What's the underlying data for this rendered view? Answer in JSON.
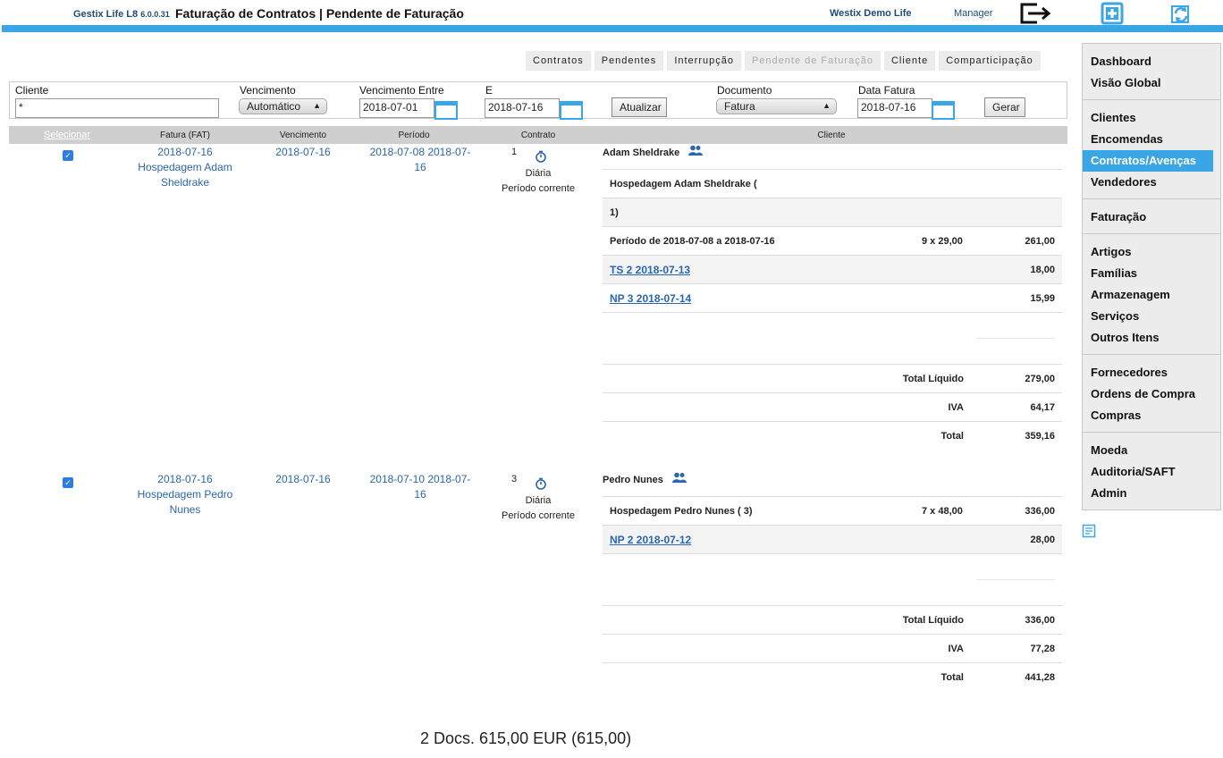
{
  "header": {
    "app_name": "Gestix Life L8",
    "version": "6.0.0.31",
    "title": "Faturação de Contratos | Pendente de Faturação",
    "company": "Westix Demo Life",
    "user": "Manager",
    "icons": [
      "logout-icon",
      "add-icon",
      "sync-icon"
    ],
    "accent_color": "#3aa6e6"
  },
  "tabs": [
    {
      "label": "Contratos",
      "disabled": false
    },
    {
      "label": "Pendentes",
      "disabled": false
    },
    {
      "label": "Interrupção",
      "disabled": false
    },
    {
      "label": "Pendente de Faturação",
      "disabled": true
    },
    {
      "label": "Cliente",
      "disabled": false
    },
    {
      "label": "Comparticipação",
      "disabled": false
    }
  ],
  "filters": {
    "cliente_label": "Cliente",
    "cliente_value": "*",
    "vencimento_label": "Vencimento",
    "vencimento_value": "Automático",
    "entre_label": "Vencimento Entre",
    "entre_value": "2018-07-01",
    "e_label": "E",
    "e_value": "2018-07-16",
    "atualizar_label": "Atualizar",
    "documento_label": "Documento",
    "documento_value": "Fatura",
    "data_fatura_label": "Data Fatura",
    "data_fatura_value": "2018-07-16",
    "gerar_label": "Gerar"
  },
  "table": {
    "headers": {
      "select": "Selecionar",
      "fatura": "Fatura (FAT)",
      "vencimento": "Vencimento",
      "periodo": "Período",
      "contrato": "Contrato",
      "cliente": "Cliente"
    },
    "rows": [
      {
        "checked": true,
        "fatura_date": "2018-07-16",
        "fatura_desc": "Hospedagem Adam Sheldrake",
        "vencimento": "2018-07-16",
        "periodo": "2018-07-08 2018-07-16",
        "contrato_num": "1",
        "contrato_freq": "Diária",
        "contrato_period": "Período corrente",
        "client_name": "Adam Sheldrake",
        "lines": [
          {
            "text": "Hospedagem Adam Sheldrake (",
            "qty": "",
            "amount": "",
            "alt": false,
            "link": false
          },
          {
            "text": "1)",
            "qty": "",
            "amount": "",
            "alt": true,
            "link": false
          },
          {
            "text": "Período de 2018-07-08 a 2018-07-16",
            "qty": "9 x 29,00",
            "amount": "261,00",
            "alt": false,
            "link": false
          },
          {
            "text": "TS 2 2018-07-13",
            "qty": "",
            "amount": "18,00",
            "alt": true,
            "link": true
          },
          {
            "text": "NP 3 2018-07-14",
            "qty": "",
            "amount": "15,99",
            "alt": false,
            "link": true
          }
        ],
        "totals": [
          {
            "label": "Total Líquido",
            "value": "279,00"
          },
          {
            "label": "IVA",
            "value": "64,17"
          },
          {
            "label": "Total",
            "value": "359,16"
          }
        ]
      },
      {
        "checked": true,
        "fatura_date": "2018-07-16",
        "fatura_desc": "Hospedagem Pedro Nunes",
        "vencimento": "2018-07-16",
        "periodo": "2018-07-10 2018-07-16",
        "contrato_num": "3",
        "contrato_freq": "Diária",
        "contrato_period": "Período corrente",
        "client_name": "Pedro Nunes",
        "lines": [
          {
            "text": "Hospedagem Pedro Nunes ( 3)",
            "qty": "7 x 48,00",
            "amount": "336,00",
            "alt": false,
            "link": false
          },
          {
            "text": "NP 2 2018-07-12",
            "qty": "",
            "amount": "28,00",
            "alt": true,
            "link": true
          }
        ],
        "totals": [
          {
            "label": "Total Líquido",
            "value": "336,00"
          },
          {
            "label": "IVA",
            "value": "77,28"
          },
          {
            "label": "Total",
            "value": "441,28"
          }
        ]
      }
    ]
  },
  "summary": "2 Docs. 615,00 EUR (615,00)",
  "sidebar": {
    "groups": [
      [
        {
          "label": "Dashboard"
        },
        {
          "label": "Visão Global"
        }
      ],
      [
        {
          "label": "Clientes"
        },
        {
          "label": "Encomendas"
        },
        {
          "label": "Contratos/Avenças",
          "active": true
        },
        {
          "label": "Vendedores"
        }
      ],
      [
        {
          "label": "Faturação"
        }
      ],
      [
        {
          "label": "Artigos"
        },
        {
          "label": "Famílias"
        },
        {
          "label": "Armazenagem"
        },
        {
          "label": "Serviços"
        },
        {
          "label": "Outros Itens"
        }
      ],
      [
        {
          "label": "Fornecedores"
        },
        {
          "label": "Ordens de Compra"
        },
        {
          "label": "Compras"
        }
      ],
      [
        {
          "label": "Moeda"
        },
        {
          "label": "Auditoria/SAFT"
        },
        {
          "label": "Admin"
        }
      ]
    ]
  }
}
